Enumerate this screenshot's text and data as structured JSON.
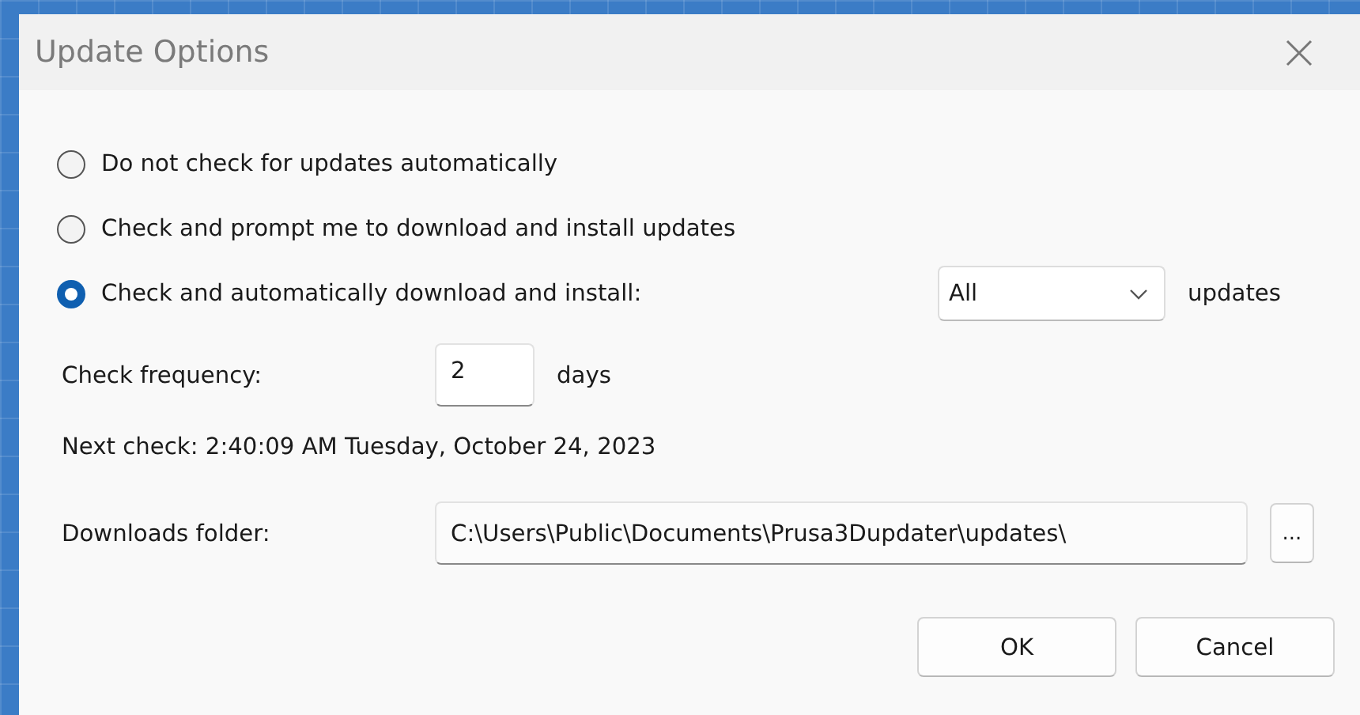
{
  "window": {
    "title": "Update Options"
  },
  "update_modes": [
    {
      "label": "Do not check for updates automatically",
      "selected": false
    },
    {
      "label": "Check and prompt me to download and install updates",
      "selected": false
    },
    {
      "label": "Check and automatically download and install:",
      "selected": true
    }
  ],
  "update_filter": {
    "value": "All",
    "suffix": "updates"
  },
  "check_frequency": {
    "label": "Check frequency:",
    "value": "2",
    "unit": "days"
  },
  "next_check": "Next check: 2:40:09 AM Tuesday, October 24, 2023",
  "downloads_folder": {
    "label": "Downloads folder:",
    "value": "C:\\Users\\Public\\Documents\\Prusa3Dupdater\\updates\\",
    "browse": "..."
  },
  "buttons": [
    "OK",
    "Cancel"
  ]
}
